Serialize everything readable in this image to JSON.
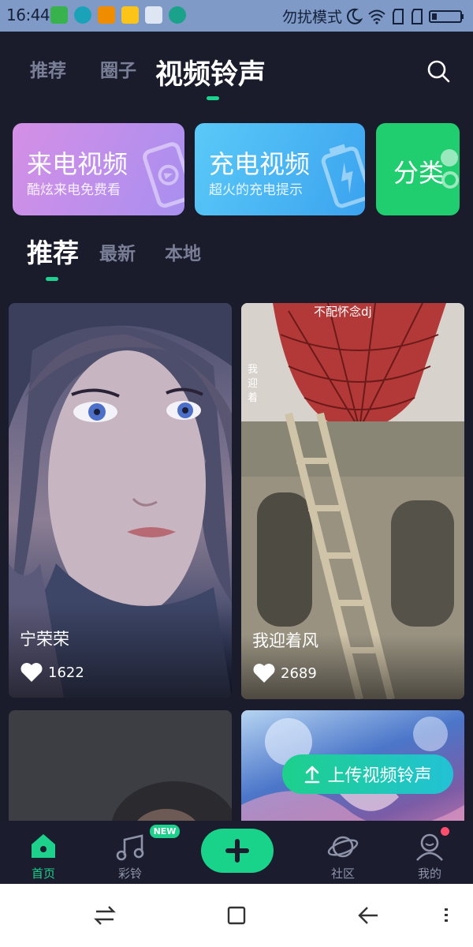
{
  "status_bar": {
    "time": "16:44",
    "dnd_label": "勿扰模式"
  },
  "top_tabs": [
    {
      "label": "推荐",
      "active": false
    },
    {
      "label": "圈子",
      "active": false
    },
    {
      "label": "视频铃声",
      "active": true
    }
  ],
  "feature_cards": [
    {
      "title": "来电视频",
      "subtitle": "酷炫来电免费看"
    },
    {
      "title": "充电视频",
      "subtitle": "超火的充电提示"
    },
    {
      "title": "分类",
      "subtitle": ""
    }
  ],
  "sub_tabs": [
    {
      "label": "推荐",
      "active": true
    },
    {
      "label": "最新",
      "active": false
    },
    {
      "label": "本地",
      "active": false
    }
  ],
  "videos": [
    {
      "title": "宁荣荣",
      "likes": "1622"
    },
    {
      "title": "我迎着风",
      "likes": "2689",
      "overlay_text": "不配怀念dj",
      "side_text": "我迎着"
    },
    {
      "title": "",
      "likes": ""
    },
    {
      "title": "",
      "likes": ""
    }
  ],
  "upload_button": {
    "label": "上传视频铃声"
  },
  "bottom_nav": [
    {
      "label": "首页",
      "icon": "home-icon",
      "active": true
    },
    {
      "label": "彩铃",
      "icon": "music-note-icon",
      "badge": "NEW"
    },
    {
      "label": "",
      "icon": "plus-icon"
    },
    {
      "label": "社区",
      "icon": "planet-icon"
    },
    {
      "label": "我的",
      "icon": "user-icon"
    }
  ],
  "colors": {
    "accent": "#1dd08b",
    "background": "#1a1c2c",
    "card_purple": "#c08ff0",
    "card_blue": "#4fbcf7",
    "card_green": "#20cd6f"
  }
}
